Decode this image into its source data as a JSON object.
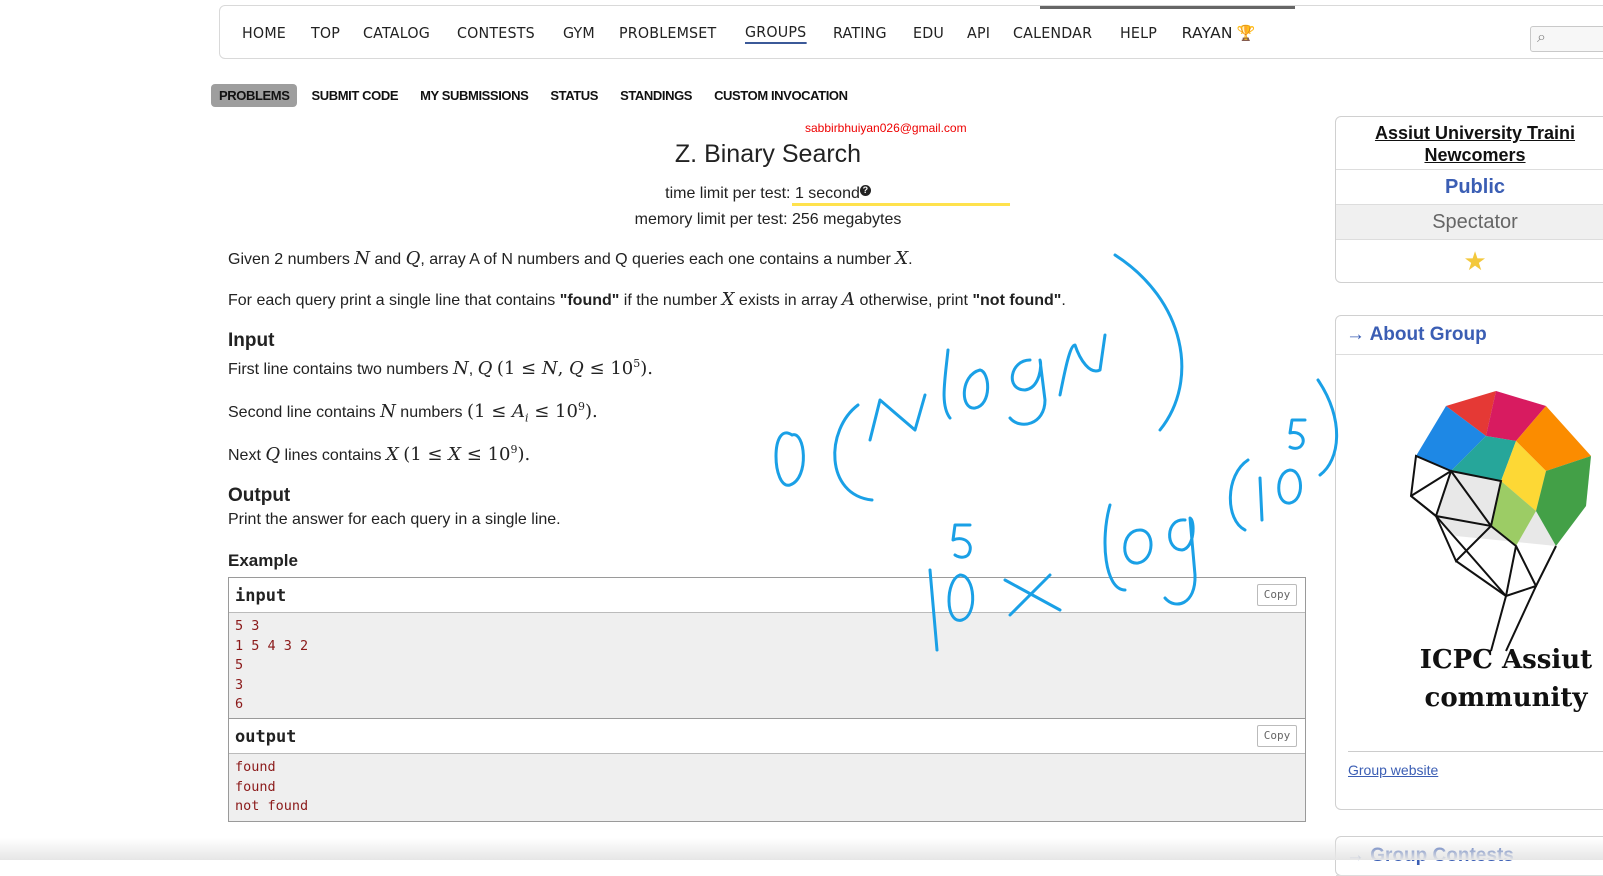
{
  "nav": {
    "items": [
      "HOME",
      "TOP",
      "CATALOG",
      "CONTESTS",
      "GYM",
      "PROBLEMSET",
      "GROUPS",
      "RATING",
      "EDU",
      "API",
      "CALENDAR",
      "HELP",
      "RAYAN"
    ],
    "active": "GROUPS",
    "trophy_icon": "trophy-icon"
  },
  "search": {
    "icon": "search-icon"
  },
  "subnav": {
    "items": [
      "PROBLEMS",
      "SUBMIT CODE",
      "MY SUBMISSIONS",
      "STATUS",
      "STANDINGS",
      "CUSTOM INVOCATION"
    ],
    "active": "PROBLEMS"
  },
  "problem": {
    "email": "sabbirbhuiyan026@gmail.com",
    "title": "Z. Binary Search",
    "time_limit_label": "time limit per test: ",
    "time_limit_value": "1 second",
    "memory_limit": "memory limit per test: 256 megabytes",
    "statement1_a": "Given 2 numbers ",
    "statement1_b": " and ",
    "statement1_c": ", array A of N numbers and Q queries each one contains a number ",
    "statement2_a": "For each query print a single line that contains ",
    "statement2_found": "\"found\"",
    "statement2_b": " if the number ",
    "statement2_c": " exists in array ",
    "statement2_d": " otherwise, print ",
    "statement2_notfound": "\"not found\"",
    "input_heading": "Input",
    "input_line1": "First line contains two numbers ",
    "input_line2": "Second line contains ",
    "input_line2_b": " numbers ",
    "input_line3_a": "Next ",
    "input_line3_b": " lines contains ",
    "output_heading": "Output",
    "output_text": "Print the answer for each query in a single line.",
    "example_heading": "Example"
  },
  "example": {
    "input_title": "input",
    "output_title": "output",
    "copy_label": "Copy",
    "input_lines": [
      "5 3",
      "1 5 4 3 2",
      "5",
      "3",
      "6"
    ],
    "output_lines": [
      "found",
      "found",
      "not found"
    ]
  },
  "sidebar": {
    "group_name_1": "Assiut University Traini",
    "group_name_2": "Newcomers",
    "visibility": "Public",
    "role": "Spectator",
    "about_title": "About Group",
    "community_1": "ICPC Assiut",
    "community_2": "community",
    "group_website": "Group website",
    "contests_title": "Group Contests"
  },
  "annotation": {
    "color": "#1aa0e6",
    "highlight_color": "#ffe24d"
  }
}
